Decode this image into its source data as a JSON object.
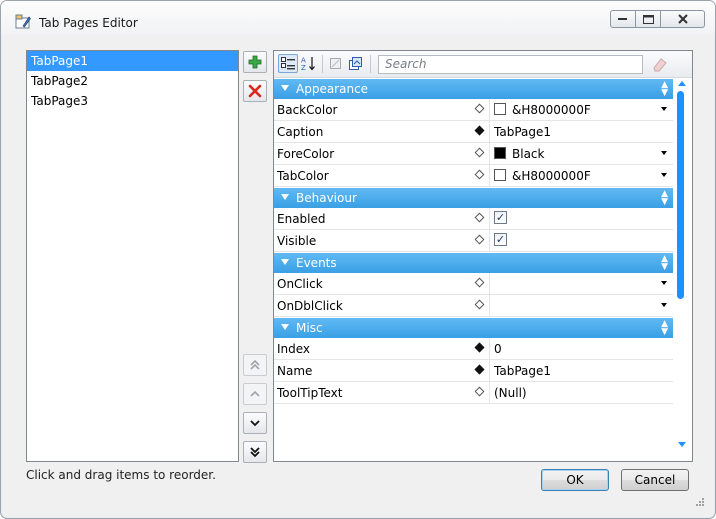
{
  "window": {
    "title": "Tab Pages Editor",
    "accent_color": "#3399ff"
  },
  "tab_list": {
    "items": [
      {
        "label": "TabPage1",
        "selected": true
      },
      {
        "label": "TabPage2",
        "selected": false
      },
      {
        "label": "TabPage3",
        "selected": false
      }
    ]
  },
  "side_buttons": {
    "add": "add-icon",
    "remove": "delete-icon",
    "move_first": "double-chevron-up-icon",
    "move_up": "chevron-up-icon",
    "move_down": "chevron-down-icon",
    "move_last": "double-chevron-down-icon"
  },
  "property_grid": {
    "search_placeholder": "Search",
    "categories": [
      {
        "name": "Appearance",
        "rows": [
          {
            "name": "BackColor",
            "value": "&H8000000F",
            "swatch": "#ffffff",
            "dropdown": true,
            "modified": false
          },
          {
            "name": "Caption",
            "value": "TabPage1",
            "modified": true
          },
          {
            "name": "ForeColor",
            "value": "Black",
            "swatch": "#000000",
            "dropdown": true,
            "modified": false
          },
          {
            "name": "TabColor",
            "value": "&H8000000F",
            "swatch": "#ffffff",
            "dropdown": true,
            "modified": false
          }
        ]
      },
      {
        "name": "Behaviour",
        "rows": [
          {
            "name": "Enabled",
            "checked": true,
            "modified": false
          },
          {
            "name": "Visible",
            "checked": true,
            "modified": false
          }
        ]
      },
      {
        "name": "Events",
        "rows": [
          {
            "name": "OnClick",
            "value": "",
            "dropdown": true,
            "modified": false
          },
          {
            "name": "OnDblClick",
            "value": "",
            "dropdown": true,
            "modified": false
          }
        ]
      },
      {
        "name": "Misc",
        "rows": [
          {
            "name": "Index",
            "value": "0",
            "modified": true
          },
          {
            "name": "Name",
            "value": "TabPage1",
            "modified": true
          },
          {
            "name": "ToolTipText",
            "value": "(Null)",
            "modified": false
          }
        ]
      }
    ]
  },
  "footer": {
    "hint": "Click and drag items to reorder.",
    "ok_label": "OK",
    "cancel_label": "Cancel"
  }
}
